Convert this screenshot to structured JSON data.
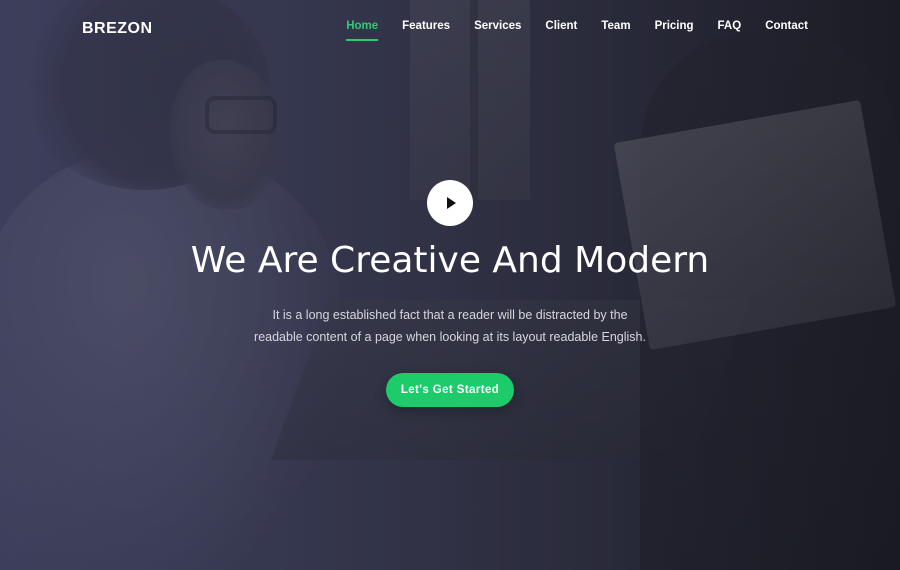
{
  "brand": {
    "logo_text": "BREZON"
  },
  "nav": {
    "items": [
      {
        "label": "Home",
        "active": true
      },
      {
        "label": "Features",
        "active": false
      },
      {
        "label": "Services",
        "active": false
      },
      {
        "label": "Client",
        "active": false
      },
      {
        "label": "Team",
        "active": false
      },
      {
        "label": "Pricing",
        "active": false
      },
      {
        "label": "FAQ",
        "active": false
      },
      {
        "label": "Contact",
        "active": false
      }
    ]
  },
  "hero": {
    "play_icon": "play-icon",
    "title": "We Are Creative And Modern",
    "description_line1": "It is a long established fact that a reader will be distracted by the",
    "description_line2": "readable content of a page when looking at its layout readable English.",
    "cta_label": "Let's Get Started"
  },
  "colors": {
    "accent": "#1ecb6a",
    "nav_active": "#2ecc71",
    "text_primary": "#ffffff",
    "text_muted": "#d6d7de"
  }
}
